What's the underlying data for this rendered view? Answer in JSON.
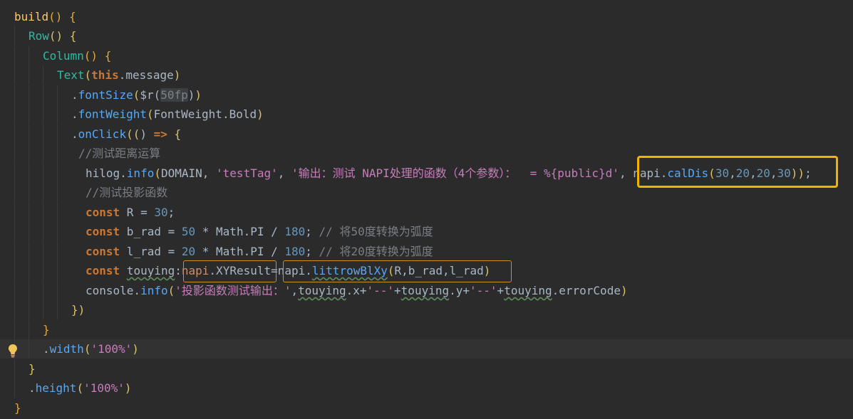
{
  "code": {
    "lines": [
      {
        "segments": [
          [
            "fn",
            "build"
          ],
          [
            "brace1",
            "() {"
          ]
        ]
      },
      {
        "segments": [
          [
            "comp",
            "Row"
          ],
          [
            "brace2",
            "() {"
          ]
        ]
      },
      {
        "segments": [
          [
            "comp",
            "Column"
          ],
          [
            "brace1",
            "() {"
          ]
        ]
      },
      {
        "segments": [
          [
            "comp",
            "Text"
          ],
          [
            "brace2",
            "("
          ],
          [
            "kw",
            "this"
          ],
          [
            "typ",
            ".message"
          ],
          [
            "brace2",
            ")"
          ]
        ]
      },
      {
        "segments": [
          [
            "typ",
            "."
          ],
          [
            "call",
            "fontSize"
          ],
          [
            "brace2",
            "("
          ],
          [
            "typ",
            "$r("
          ],
          [
            "hlfp",
            "50fp"
          ],
          [
            "typ",
            ")"
          ],
          [
            "brace2",
            ")"
          ]
        ]
      },
      {
        "segments": [
          [
            "typ",
            "."
          ],
          [
            "call",
            "fontWeight"
          ],
          [
            "brace2",
            "("
          ],
          [
            "typ",
            "FontWeight.Bold"
          ],
          [
            "brace2",
            ")"
          ]
        ]
      },
      {
        "segments": [
          [
            "typ",
            "."
          ],
          [
            "call",
            "onClick"
          ],
          [
            "brace2",
            "(("
          ],
          [
            "typ",
            ") "
          ],
          [
            "kw",
            "=>"
          ],
          [
            "brace2",
            " {"
          ]
        ]
      },
      {
        "segments": [
          [
            "cmt",
            "//测试距离运算"
          ]
        ]
      },
      {
        "segments": [
          [
            "typ",
            "hilog."
          ],
          [
            "call",
            "info"
          ],
          [
            "brace2",
            "("
          ],
          [
            "typ",
            "DOMAIN, "
          ],
          [
            "strp",
            "'testTag'"
          ],
          [
            "typ",
            ", "
          ],
          [
            "strp",
            "'输出：测试 NAPI处理的函数（4个参数）：  = %{public}d'"
          ],
          [
            "typ",
            ", napi."
          ],
          [
            "call",
            "calDis"
          ],
          [
            "brace2",
            "("
          ],
          [
            "num",
            "30"
          ],
          [
            "typ",
            ","
          ],
          [
            "num",
            "20"
          ],
          [
            "typ",
            ","
          ],
          [
            "num",
            "20"
          ],
          [
            "typ",
            ","
          ],
          [
            "num",
            "30"
          ],
          [
            "brace2",
            "))"
          ],
          [
            "typ",
            ";"
          ]
        ]
      },
      {
        "segments": [
          [
            "cmt",
            "//测试投影函数"
          ]
        ]
      },
      {
        "segments": [
          [
            "kw",
            "const"
          ],
          [
            "typ",
            " R = "
          ],
          [
            "num",
            "30"
          ],
          [
            "typ",
            ";"
          ]
        ]
      },
      {
        "segments": [
          [
            "kw",
            "const"
          ],
          [
            "typ",
            " b_rad = "
          ],
          [
            "num",
            "50"
          ],
          [
            "typ",
            " * Math.PI / "
          ],
          [
            "num",
            "180"
          ],
          [
            "typ",
            "; "
          ],
          [
            "cmt",
            "// 将50度转换为弧度"
          ]
        ]
      },
      {
        "segments": [
          [
            "kw",
            "const"
          ],
          [
            "typ",
            " l_rad = "
          ],
          [
            "num",
            "20"
          ],
          [
            "typ",
            " * Math.PI / "
          ],
          [
            "num",
            "180"
          ],
          [
            "typ",
            "; "
          ],
          [
            "cmt",
            "// 将20度转换为弧度"
          ]
        ]
      },
      {
        "segments": [
          [
            "kw",
            "const"
          ],
          [
            "typ",
            " "
          ],
          [
            "squig",
            "touying"
          ],
          [
            "typ",
            ":"
          ],
          [
            "napi",
            "napi"
          ],
          [
            "typ",
            ".XYResult=napi."
          ],
          [
            "call squig",
            "littrowBlXy"
          ],
          [
            "brace2",
            "("
          ],
          [
            "typ",
            "R,b_rad,l_rad"
          ],
          [
            "brace2",
            ")"
          ]
        ]
      },
      {
        "segments": [
          [
            "typ",
            "console."
          ],
          [
            "call",
            "info"
          ],
          [
            "brace2",
            "("
          ],
          [
            "strp",
            "'投影函数测试输出：'"
          ],
          [
            "typ",
            ","
          ],
          [
            "squig",
            "touying"
          ],
          [
            "typ",
            ".x+"
          ],
          [
            "strp",
            "'--'"
          ],
          [
            "typ",
            "+"
          ],
          [
            "squig",
            "touying"
          ],
          [
            "typ",
            ".y+"
          ],
          [
            "strp",
            "'--'"
          ],
          [
            "typ",
            "+"
          ],
          [
            "squig",
            "touying"
          ],
          [
            "typ",
            ".errorCode"
          ],
          [
            "brace2",
            ")"
          ]
        ]
      },
      {
        "segments": [
          [
            "brace2",
            "})"
          ]
        ]
      },
      {
        "segments": [
          [
            "brace1",
            "}"
          ]
        ]
      },
      {
        "segments": [
          [
            "typ",
            "."
          ],
          [
            "call",
            "width"
          ],
          [
            "brace2",
            "("
          ],
          [
            "strp",
            "'100%'"
          ],
          [
            "brace2",
            ")"
          ]
        ]
      },
      {
        "segments": [
          [
            "brace2",
            "}"
          ]
        ]
      },
      {
        "segments": [
          [
            "typ",
            "."
          ],
          [
            "call",
            "height"
          ],
          [
            "brace2",
            "("
          ],
          [
            "strp",
            "'100%'"
          ],
          [
            "brace2",
            ")"
          ]
        ]
      },
      {
        "segments": [
          [
            "brace1",
            "}"
          ]
        ]
      }
    ]
  },
  "highlight_labels": {
    "caldis_box": "napi.calDis(30,20,20,30));",
    "napi_type_box": "napi.XYResult",
    "littrow_box": "napi.littrowBlXy(R,b_rad,l_rad)"
  },
  "icons": {
    "gutter": "lightbulb-icon"
  }
}
